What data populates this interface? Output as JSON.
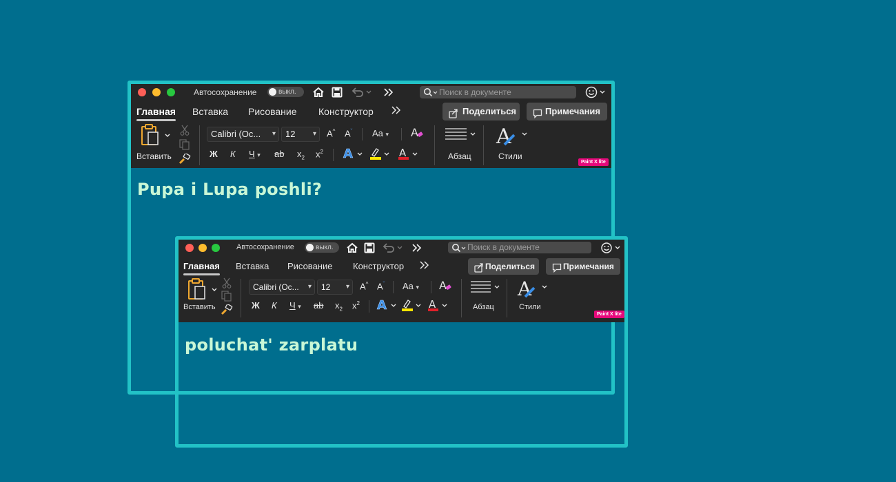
{
  "colors": {
    "background": "#006e8e",
    "frame_border": "#22c2c6",
    "toolbar_bg": "#262626",
    "document_text": "#c9f7d6",
    "badge": "#e6097b",
    "highlight_yellow": "#ffe600",
    "font_color_red": "#e0202a"
  },
  "window1": {
    "autosave_label": "Автосохранение",
    "autosave_state": "выкл.",
    "search_placeholder": "Поиск в документе",
    "tabs": [
      "Главная",
      "Вставка",
      "Рисование",
      "Конструктор"
    ],
    "active_tab": "Главная",
    "share_label": "Поделиться",
    "comments_label": "Примечания",
    "paste_label": "Вставить",
    "font_name": "Calibri (Ос...",
    "font_size": "12",
    "paragraph_label": "Абзац",
    "styles_label": "Стили",
    "badge_text": "Paint X lite",
    "bold_glyph": "Ж",
    "italic_glyph": "К",
    "underline_glyph": "Ч",
    "strike_glyph": "ab",
    "case_glyph": "Aa",
    "document_text": "Pupa i Lupa poshli?"
  },
  "window2": {
    "autosave_label": "Автосохранение",
    "autosave_state": "выкл.",
    "search_placeholder": "Поиск в документе",
    "tabs": [
      "Главная",
      "Вставка",
      "Рисование",
      "Конструктор"
    ],
    "active_tab": "Главная",
    "share_label": "Поделиться",
    "comments_label": "Примечания",
    "paste_label": "Вставить",
    "font_name": "Calibri (Ос...",
    "font_size": "12",
    "paragraph_label": "Абзац",
    "styles_label": "Стили",
    "badge_text": "Paint X lite",
    "bold_glyph": "Ж",
    "italic_glyph": "К",
    "underline_glyph": "Ч",
    "strike_glyph": "ab",
    "case_glyph": "Aa",
    "document_text": "poluchat' zarplatu"
  }
}
